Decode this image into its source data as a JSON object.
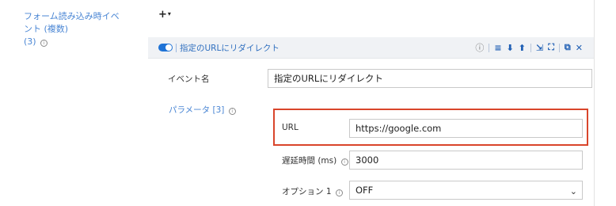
{
  "form_events": {
    "label": "フォーム読み込み時イベント (複数)",
    "count": "(3)",
    "info_icon": "info-icon",
    "add_symbol": "+",
    "add_caret": "▾"
  },
  "event": {
    "enabled": true,
    "header_title": "指定のURLにリダイレクト",
    "accent_color": "#1f73d6",
    "toolbar": {
      "info": "ⓘ",
      "menu": "≡",
      "move_down": "⬇",
      "move_up": "⬆",
      "collapse": "⇲",
      "expand": "⛶",
      "copy": "⧉",
      "close": "✕"
    },
    "name_label": "イベント名",
    "name_value": "指定のURLにリダイレクト",
    "params_label": "パラメータ [3]",
    "params": {
      "url_label": "URL",
      "url_value": "https://google.com",
      "delay_label": "遅延時間 (ms)",
      "delay_value": "3000",
      "option1_label": "オプション 1",
      "option1_value": "OFF"
    },
    "highlight_color": "#d9452b"
  }
}
